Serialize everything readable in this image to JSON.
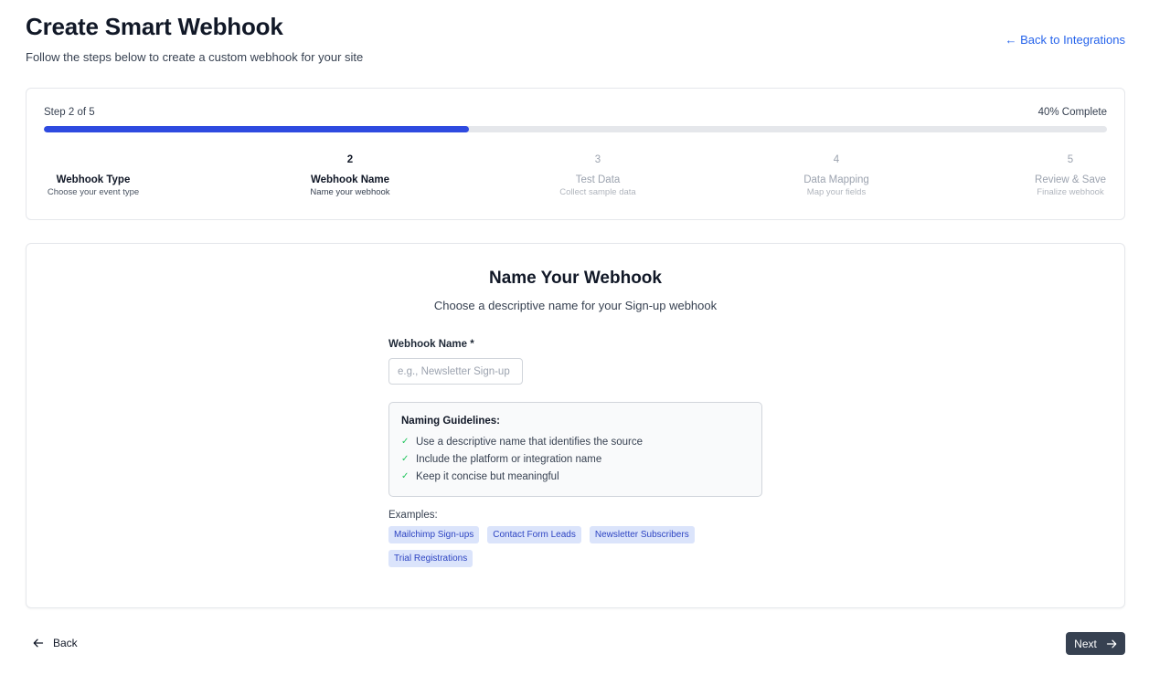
{
  "header": {
    "title": "Create Smart Webhook",
    "subtitle": "Follow the steps below to create a custom webhook for your site",
    "back_link": "← Back to Integrations"
  },
  "progress": {
    "step_label": "Step 2 of 5",
    "complete_label": "40% Complete",
    "fraction": 0.4,
    "accent_color": "#2e4ae0",
    "steps": [
      {
        "number": "",
        "title": "Webhook Type",
        "desc": "Choose your event type",
        "state": "done"
      },
      {
        "number": "2",
        "title": "Webhook Name",
        "desc": "Name your webhook",
        "state": "active"
      },
      {
        "number": "3",
        "title": "Test Data",
        "desc": "Collect sample data",
        "state": "pending"
      },
      {
        "number": "4",
        "title": "Data Mapping",
        "desc": "Map your fields",
        "state": "pending"
      },
      {
        "number": "5",
        "title": "Review & Save",
        "desc": "Finalize webhook",
        "state": "pending"
      }
    ]
  },
  "form": {
    "title": "Name Your Webhook",
    "subtitle": "Choose a descriptive name for your Sign-up webhook",
    "field_label": "Webhook Name *",
    "placeholder": "e.g., Newsletter Sign-up",
    "value": ""
  },
  "guidelines": {
    "title": "Naming Guidelines:",
    "check_icon": "check-icon",
    "items": [
      "Use a descriptive name that identifies the source",
      "Include the platform or integration name",
      "Keep it concise but meaningful"
    ]
  },
  "examples": {
    "label": "Examples:",
    "chips": [
      "Mailchimp Sign-ups",
      "Contact Form Leads",
      "Newsletter Subscribers",
      "Trial Registrations"
    ]
  },
  "footer": {
    "back_label": "Back",
    "next_label": "Next",
    "back_icon": "arrow-left-icon",
    "next_icon": "arrow-right-icon"
  }
}
